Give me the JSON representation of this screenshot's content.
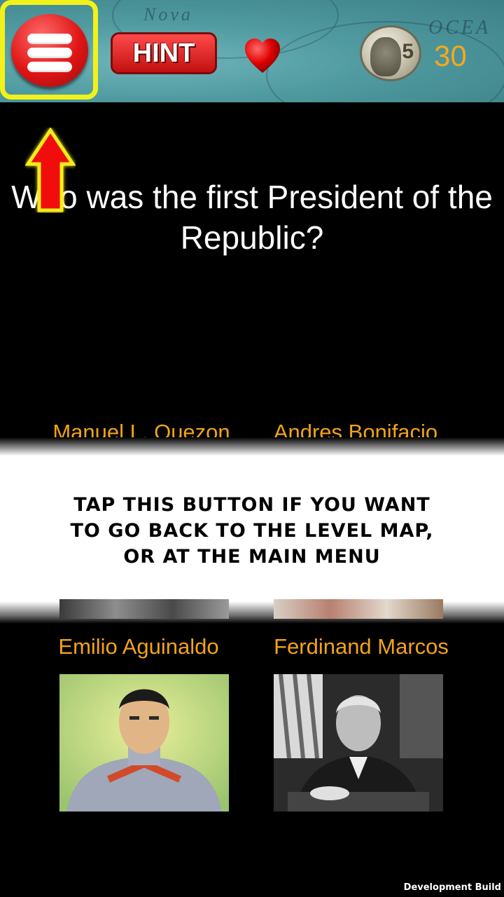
{
  "header": {
    "hint_label": "HINT",
    "coin_face_value": "5",
    "coins_count": "30",
    "map_labels": [
      "Nova",
      "OCEA"
    ]
  },
  "question": {
    "text": "Who was the first President of the Republic?"
  },
  "answers": [
    {
      "label": "Manuel L. Quezon"
    },
    {
      "label": "Andres Bonifacio"
    },
    {
      "label": "Emilio Aguinaldo"
    },
    {
      "label": "Ferdinand Marcos"
    }
  ],
  "tutorial": {
    "line1": "TAP THIS BUTTON IF YOU WANT",
    "line2": "TO GO BACK TO THE LEVEL MAP,",
    "line3": "OR AT THE MAIN MENU"
  },
  "footer": {
    "build_label": "Development Build"
  },
  "colors": {
    "highlight": "#f2f21a",
    "answer_text": "#f2a318",
    "coin_count": "#f7a81b"
  }
}
